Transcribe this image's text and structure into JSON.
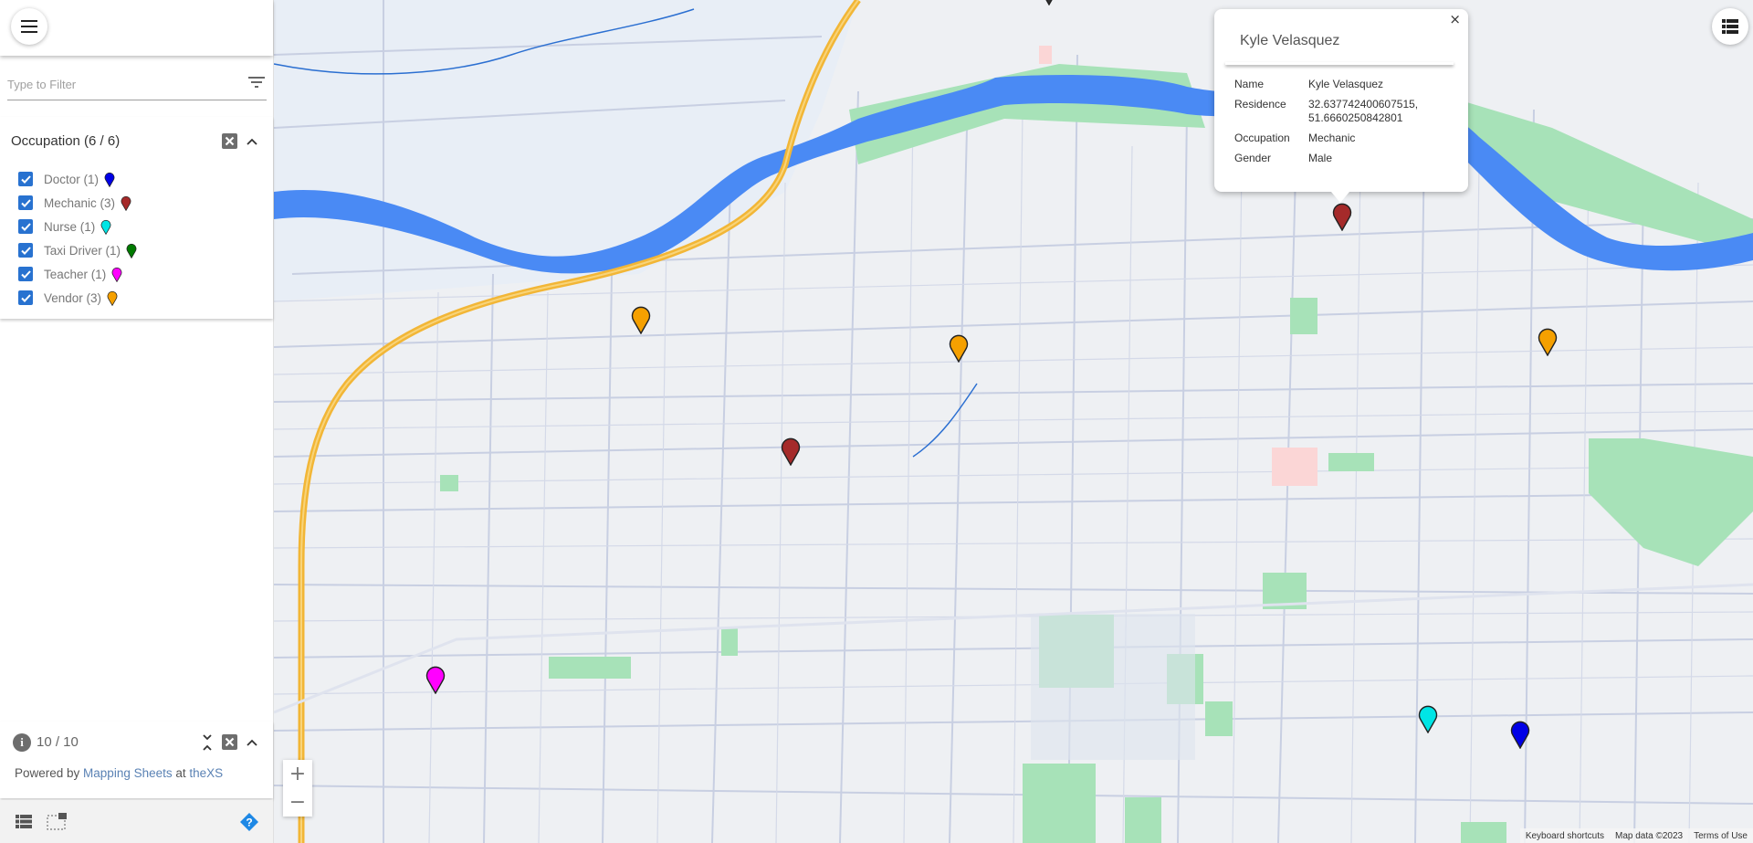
{
  "sidebar": {
    "menu_icon": "hamburger-menu-icon",
    "filter": {
      "placeholder": "Type to Filter",
      "value": "",
      "icon": "filter-icon"
    },
    "group": {
      "title": "Occupation (6 / 6)",
      "clear_icon": "clear-box-icon",
      "collapse_icon": "chevron-up-icon",
      "items": [
        {
          "label": "Doctor (1)",
          "checked": true,
          "color": "#0000e6"
        },
        {
          "label": "Mechanic (3)",
          "checked": true,
          "color": "#a52a2a"
        },
        {
          "label": "Nurse (1)",
          "checked": true,
          "color": "#00e5e5"
        },
        {
          "label": "Taxi Driver (1)",
          "checked": true,
          "color": "#007a00"
        },
        {
          "label": "Teacher (1)",
          "checked": true,
          "color": "#ff00ff"
        },
        {
          "label": "Vendor (3)",
          "checked": true,
          "color": "#f5a000"
        }
      ]
    },
    "info": {
      "count": "10 / 10",
      "powered_prefix": "Powered by ",
      "powered_link": "Mapping Sheets",
      "powered_mid": " at ",
      "powered_link2": "theXS"
    },
    "footer": {
      "icons": [
        "list-view-icon",
        "select-area-icon",
        "help-icon"
      ]
    }
  },
  "map": {
    "controls": {
      "zoom_in": "+",
      "zoom_out": "−",
      "layers_icon": "layers-list-icon"
    },
    "attribution": {
      "shortcuts": "Keyboard shortcuts",
      "data": "Map data ©2023",
      "terms": "Terms of Use"
    },
    "colors": {
      "water": "#4a8af4",
      "park": "#a7e2b8",
      "highway": "#f2b636",
      "road": "#c4cbe0",
      "land": "#eef0f3"
    },
    "markers": [
      {
        "category": "Mechanic",
        "color": "#a52a2a",
        "selected": true
      },
      {
        "category": "Mechanic",
        "color": "#a52a2a"
      },
      {
        "category": "Vendor",
        "color": "#f5a000"
      },
      {
        "category": "Vendor",
        "color": "#f5a000"
      },
      {
        "category": "Vendor",
        "color": "#f5a000"
      },
      {
        "category": "Teacher",
        "color": "#ff00ff"
      },
      {
        "category": "Nurse",
        "color": "#00e5e5"
      },
      {
        "category": "Doctor",
        "color": "#0000e6"
      },
      {
        "category": "Unknown (off-screen)",
        "color": "#333333"
      }
    ]
  },
  "popup": {
    "title": "Kyle Velasquez",
    "close": "×",
    "rows": [
      {
        "key": "Name",
        "value": "Kyle Velasquez"
      },
      {
        "key": "Residence",
        "value": "32.637742400607515, 51.6660250842801"
      },
      {
        "key": "Occupation",
        "value": "Mechanic"
      },
      {
        "key": "Gender",
        "value": "Male"
      }
    ]
  }
}
